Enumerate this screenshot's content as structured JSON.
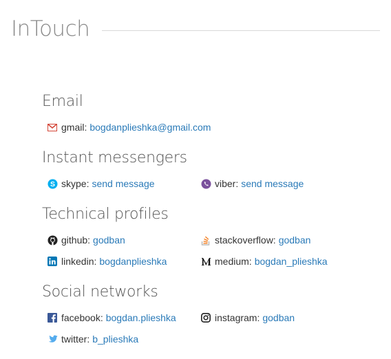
{
  "header": {
    "title": "InTouch"
  },
  "sections": {
    "email": {
      "title": "Email",
      "gmail": {
        "label": "gmail:",
        "value": "bogdanplieshka@gmail.com"
      }
    },
    "messengers": {
      "title": "Instant messengers",
      "skype": {
        "label": "skype:",
        "value": "send message"
      },
      "viber": {
        "label": "viber:",
        "value": "send message"
      }
    },
    "technical": {
      "title": "Technical profiles",
      "github": {
        "label": "github:",
        "value": "godban"
      },
      "stackoverflow": {
        "label": "stackoverflow:",
        "value": "godban"
      },
      "linkedin": {
        "label": "linkedin:",
        "value": "bogdanplieshka"
      },
      "medium": {
        "label": "medium:",
        "value": "bogdan_plieshka"
      }
    },
    "social": {
      "title": "Social networks",
      "facebook": {
        "label": "facebook:",
        "value": "bogdan.plieshka"
      },
      "instagram": {
        "label": "instagram:",
        "value": "godban"
      },
      "twitter": {
        "label": "twitter:",
        "value": "b_plieshka"
      }
    }
  },
  "colors": {
    "link": "#2a7ab8",
    "gmail": "#d44638",
    "skype": "#00aff0",
    "viber": "#7b519d",
    "linkedin": "#0077b5",
    "facebook": "#3b5998",
    "twitter": "#55acee",
    "stackoverflow": "#bcbbbb"
  }
}
